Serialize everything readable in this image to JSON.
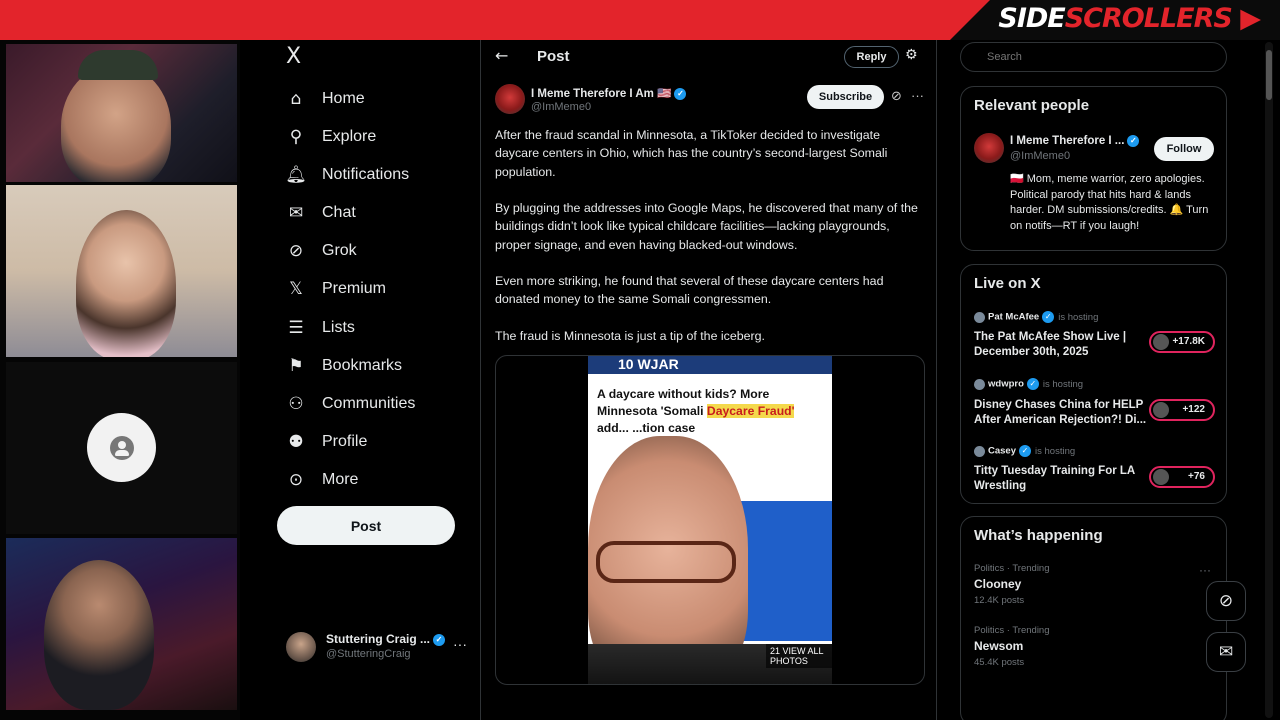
{
  "overlay": {
    "brand_part1": "SIDE",
    "brand_part2": "SCROLLERS"
  },
  "nav": {
    "logo": "X",
    "items": [
      {
        "label": "Home",
        "icon": "home-icon",
        "glyph": "⌂"
      },
      {
        "label": "Explore",
        "icon": "search-icon",
        "glyph": "⚲"
      },
      {
        "label": "Notifications",
        "icon": "bell-icon",
        "glyph": "🔔︎"
      },
      {
        "label": "Chat",
        "icon": "mail-icon",
        "glyph": "✉"
      },
      {
        "label": "Grok",
        "icon": "grok-icon",
        "glyph": "⊘"
      },
      {
        "label": "Premium",
        "icon": "x-icon",
        "glyph": "𝕏"
      },
      {
        "label": "Lists",
        "icon": "list-icon",
        "glyph": "☰"
      },
      {
        "label": "Bookmarks",
        "icon": "bookmark-icon",
        "glyph": "⚑"
      },
      {
        "label": "Communities",
        "icon": "communities-icon",
        "glyph": "⚇"
      },
      {
        "label": "Profile",
        "icon": "profile-icon",
        "glyph": "⚉"
      },
      {
        "label": "More",
        "icon": "more-circle-icon",
        "glyph": "⊙"
      }
    ],
    "post_button": "Post",
    "account": {
      "name": "Stuttering Craig ...",
      "handle": "@StutteringCraig",
      "more": "···"
    }
  },
  "post": {
    "header_title": "Post",
    "reply_button": "Reply",
    "author_name": "I Meme Therefore I Am 🇺🇸",
    "author_handle": "@ImMeme0",
    "subscribe_button": "Subscribe",
    "paragraphs": [
      "After the fraud scandal in Minnesota, a TikToker decided to investigate daycare centers in Ohio, which has the country’s second-largest Somali population.",
      "By plugging the addresses into Google Maps, he discovered that many of the buildings didn’t look like typical childcare facilities—lacking playgrounds, proper signage, and even having blacked-out windows.",
      "Even more striking, he found that several of these daycare centers had donated money to the same Somali congressmen.",
      "The fraud is Minnesota is just a tip of the iceberg."
    ],
    "media": {
      "station_logo": "10 WJAR",
      "headline_a": "A daycare without kids? More Minnesota 'Somali ",
      "headline_highlight": "Daycare Fraud'",
      "headline_b": " add... ...tion case",
      "photos_label": "21 VIEW ALL PHOTOS"
    }
  },
  "sidebar": {
    "search_placeholder": "Search",
    "relevant": {
      "title": "Relevant people",
      "name": "I Meme Therefore I ...",
      "handle": "@ImMeme0",
      "follow_button": "Follow",
      "bio": "🇵🇱 Mom, meme warrior, zero apologies. Political parody that hits hard & lands harder. DM submissions/credits. 🔔 Turn on notifs—RT if you laugh!"
    },
    "live": {
      "title": "Live on X",
      "hosting_label": "is hosting",
      "items": [
        {
          "host": "Pat McAfee",
          "title": "The Pat McAfee Show Live | December 30th, 2025",
          "count": "+17.8K"
        },
        {
          "host": "wdwpro",
          "title": "Disney Chases China for HELP After American Rejection?! Di...",
          "count": "+122"
        },
        {
          "host": "Casey",
          "title": "Titty Tuesday Training For LA Wrestling",
          "count": "+76"
        }
      ]
    },
    "happening": {
      "title": "What’s happening",
      "trends": [
        {
          "category": "Politics · Trending",
          "name": "Clooney",
          "posts": "12.4K posts"
        },
        {
          "category": "Politics · Trending",
          "name": "Newsom",
          "posts": "45.4K posts"
        }
      ],
      "more": "···"
    }
  },
  "colors": {
    "banner_red": "#e3242b",
    "verified_blue": "#1d9bf0",
    "live_ring": "#e0245e"
  }
}
